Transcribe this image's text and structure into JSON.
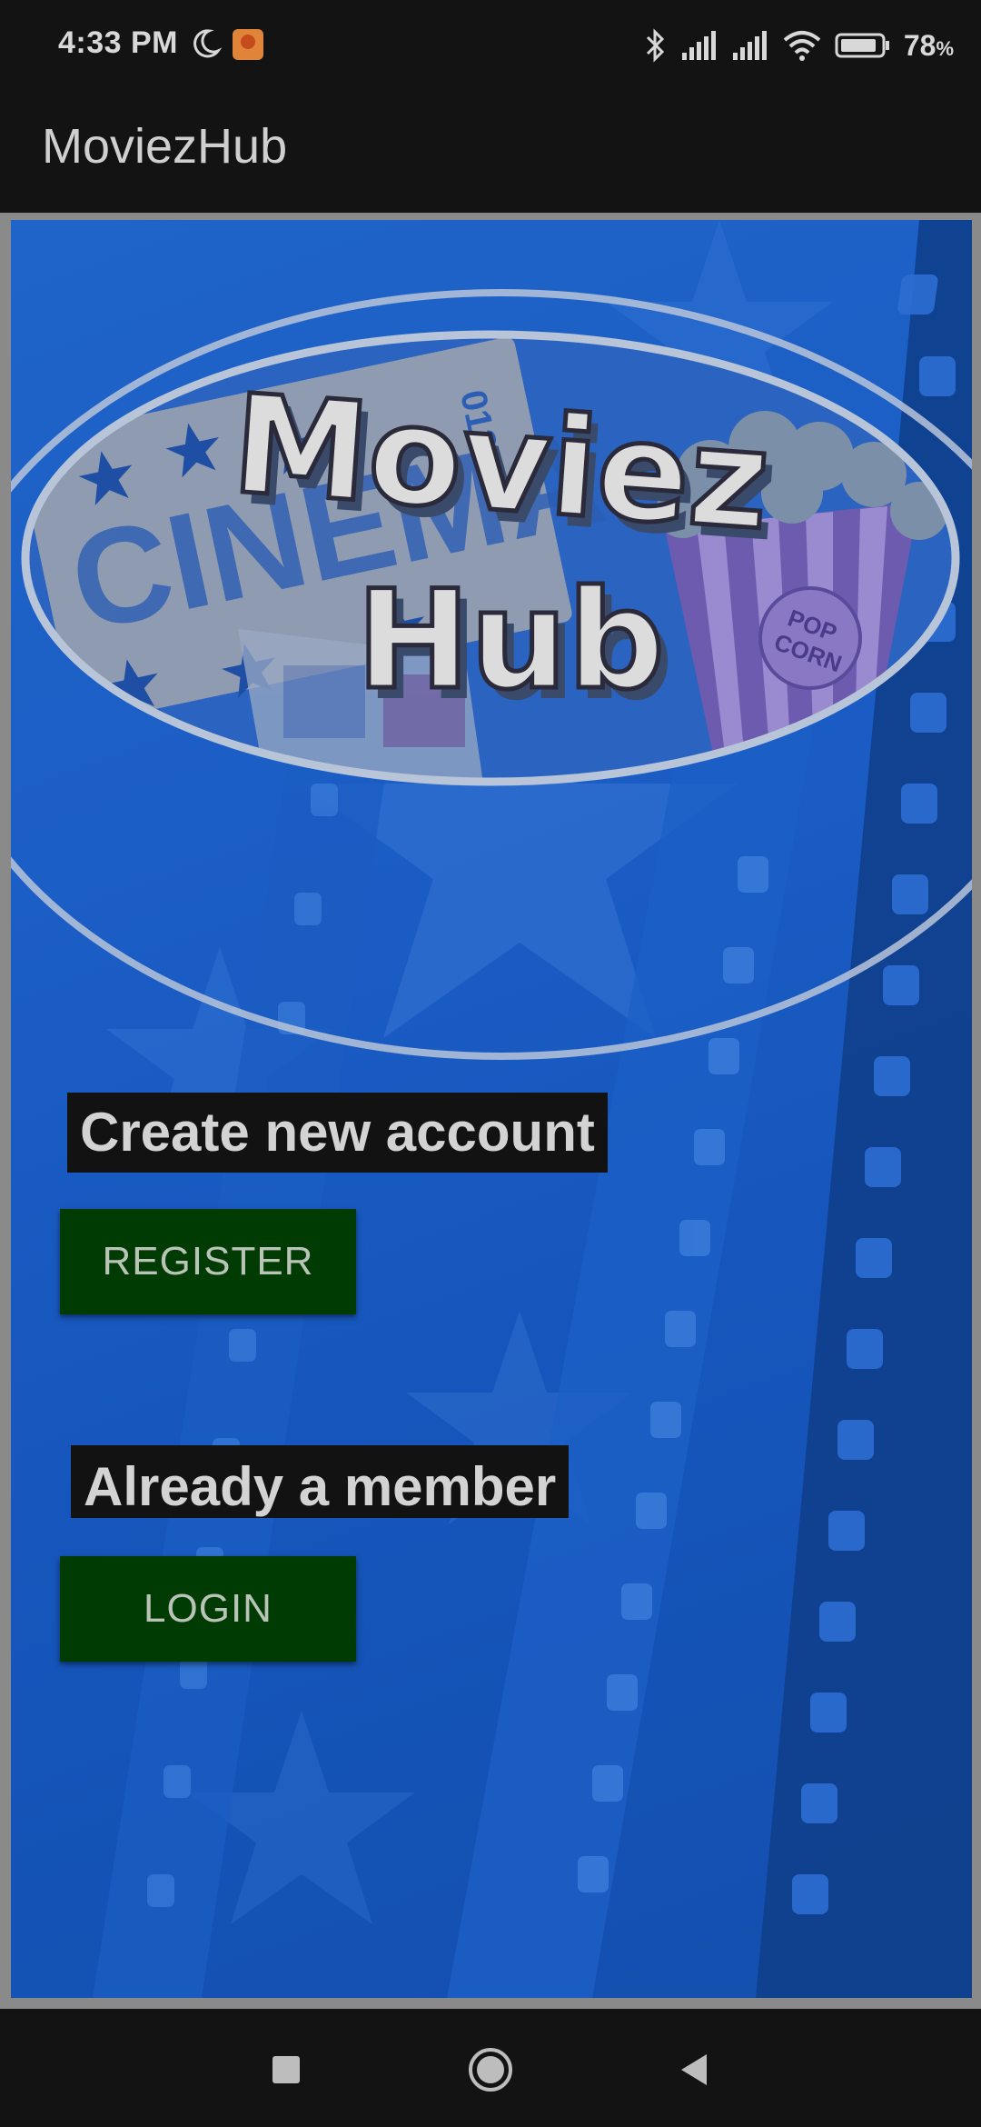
{
  "status_bar": {
    "time": "4:33 PM",
    "battery_percent": "78",
    "battery_unit": "%",
    "icons": [
      "moon-icon",
      "app-notification-icon",
      "bluetooth-icon",
      "signal-icon",
      "signal-icon",
      "wifi-icon",
      "battery-icon"
    ]
  },
  "app_bar": {
    "title": "MoviezHub"
  },
  "logo": {
    "word_top": "Moviez",
    "word_bottom": "Hub",
    "ticket_text": "CINEMA",
    "ticket_number": "01234",
    "popcorn_text_1": "POP",
    "popcorn_text_2": "CORN"
  },
  "main": {
    "create_label": "Create new account",
    "register_button": "REGISTER",
    "member_label": "Already a member",
    "login_button": "LOGIN"
  },
  "nav_bar": {
    "buttons": [
      "recents-icon",
      "home-icon",
      "back-icon"
    ]
  },
  "colors": {
    "background_blue": "#1a5cc4",
    "button_green": "#003b04",
    "bar_dark": "#131313"
  }
}
